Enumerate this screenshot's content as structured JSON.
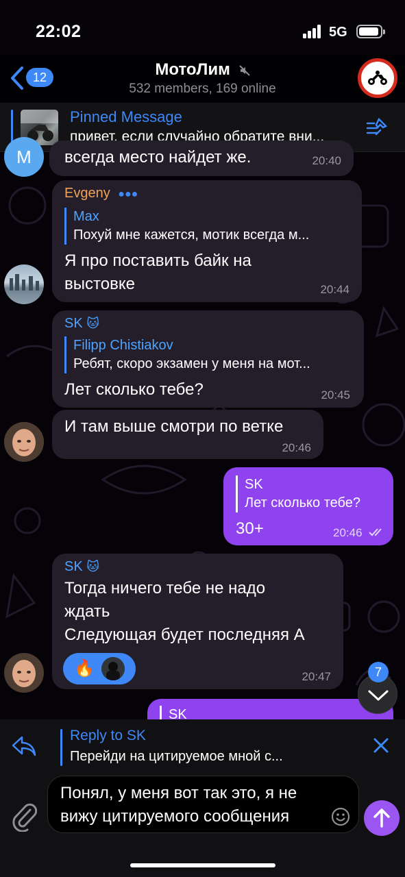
{
  "status_bar": {
    "time": "22:02",
    "network": "5G"
  },
  "header": {
    "back_count": "12",
    "title": "МотоЛим",
    "subtitle": "532 members, 169 online"
  },
  "pinned": {
    "title": "Pinned Message",
    "text": "привет. если случайно обратите вни..."
  },
  "messages": [
    {
      "id": "m0",
      "text": "всегда место найдет же.",
      "time": "20:40",
      "avatar_letter": "М"
    },
    {
      "id": "m1",
      "sender": "Evgeny",
      "sender_color": "#f2a358",
      "reply_name": "Max",
      "reply_text": "Похуй мне кажется, мотик всегда м...",
      "text_lines": [
        "Я про поставить байк на",
        "выстовке"
      ],
      "time": "20:44"
    },
    {
      "id": "m2",
      "sender": "SK",
      "sender_color": "#4da3ff",
      "reply_name": "Filipp Chistiakov",
      "reply_text": "Ребят, скоро экзамен у меня на мот...",
      "text": "Лет сколько тебе?",
      "time": "20:45"
    },
    {
      "id": "m3",
      "text": "И там выше смотри по ветке",
      "time": "20:46"
    },
    {
      "id": "m4",
      "reply_name": "SK",
      "reply_text": "Лет сколько тебе?",
      "text": "30+",
      "time": "20:46"
    },
    {
      "id": "m5",
      "sender": "SK",
      "sender_color": "#4da3ff",
      "text_lines": [
        "Тогда ничего тебе не надо",
        "ждать",
        "Следующая будет последняя А"
      ],
      "time": "20:47",
      "reaction": "🔥"
    },
    {
      "id": "m6",
      "reply_name": "SK"
    }
  ],
  "reply_panel": {
    "title": "Reply to SK",
    "preview": "Перейди на цитируемое мной с..."
  },
  "composer": {
    "text": "Понял, у меня вот так это, я не вижу цитируемого сообщения"
  },
  "scroll_badge": "7",
  "colors": {
    "accent": "#3e88f7",
    "outgoing": "#8e43ee",
    "incoming": "#241e2a"
  }
}
